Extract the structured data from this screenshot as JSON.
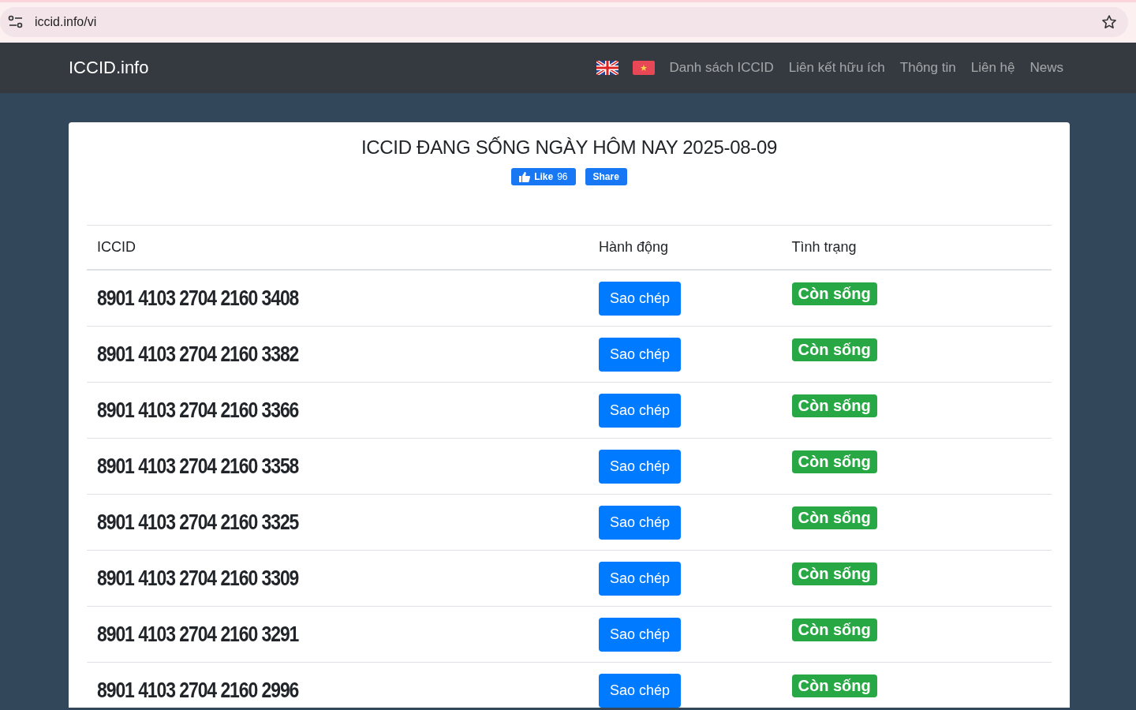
{
  "browser": {
    "url": "iccid.info/vi"
  },
  "navbar": {
    "brand": "ICCID.info",
    "links": [
      "Danh sách ICCID",
      "Liên kết hữu ích",
      "Thông tin",
      "Liên hệ",
      "News"
    ]
  },
  "card": {
    "title": "ICCID ĐANG SỐNG NGÀY HÔM NAY 2025-08-09",
    "like_button": "Like",
    "like_count": "96",
    "share_button": "Share"
  },
  "table": {
    "columns": [
      "ICCID",
      "Hành động",
      "Tình trạng"
    ],
    "rows": [
      {
        "iccid": "8901 4103 2704 2160 3408",
        "action": "Sao chép",
        "status": "Còn sống"
      },
      {
        "iccid": "8901 4103 2704 2160 3382",
        "action": "Sao chép",
        "status": "Còn sống"
      },
      {
        "iccid": "8901 4103 2704 2160 3366",
        "action": "Sao chép",
        "status": "Còn sống"
      },
      {
        "iccid": "8901 4103 2704 2160 3358",
        "action": "Sao chép",
        "status": "Còn sống"
      },
      {
        "iccid": "8901 4103 2704 2160 3325",
        "action": "Sao chép",
        "status": "Còn sống"
      },
      {
        "iccid": "8901 4103 2704 2160 3309",
        "action": "Sao chép",
        "status": "Còn sống"
      },
      {
        "iccid": "8901 4103 2704 2160 3291",
        "action": "Sao chép",
        "status": "Còn sống"
      },
      {
        "iccid": "8901 4103 2704 2160 2996",
        "action": "Sao chép",
        "status": "Còn sống"
      }
    ]
  }
}
